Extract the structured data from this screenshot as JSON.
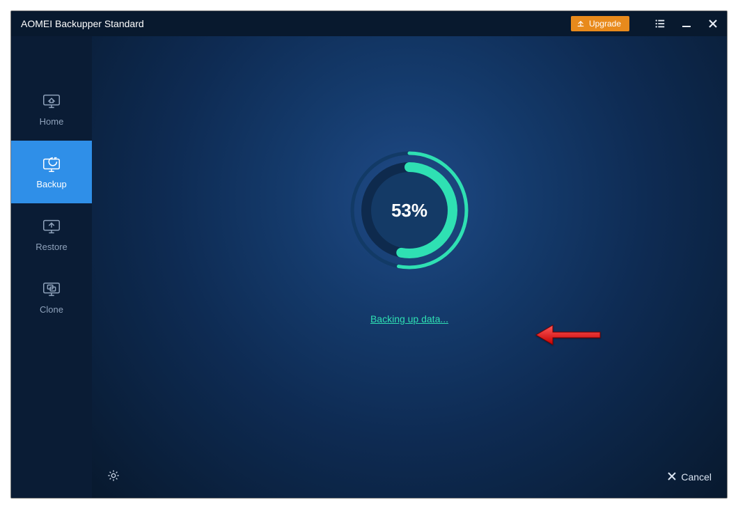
{
  "app": {
    "title": "AOMEI Backupper Standard"
  },
  "titlebar": {
    "upgrade_label": "Upgrade"
  },
  "sidebar": {
    "items": [
      {
        "label": "Home"
      },
      {
        "label": "Backup"
      },
      {
        "label": "Restore"
      },
      {
        "label": "Clone"
      }
    ],
    "active_index": 1
  },
  "progress": {
    "percent": 53,
    "percent_label": "53%",
    "status_text": "Backing up data..."
  },
  "footer": {
    "cancel_label": "Cancel"
  },
  "colors": {
    "accent_green": "#2fe0b3",
    "sidebar_active": "#2f8fe8",
    "upgrade_orange": "#e88a1c"
  }
}
